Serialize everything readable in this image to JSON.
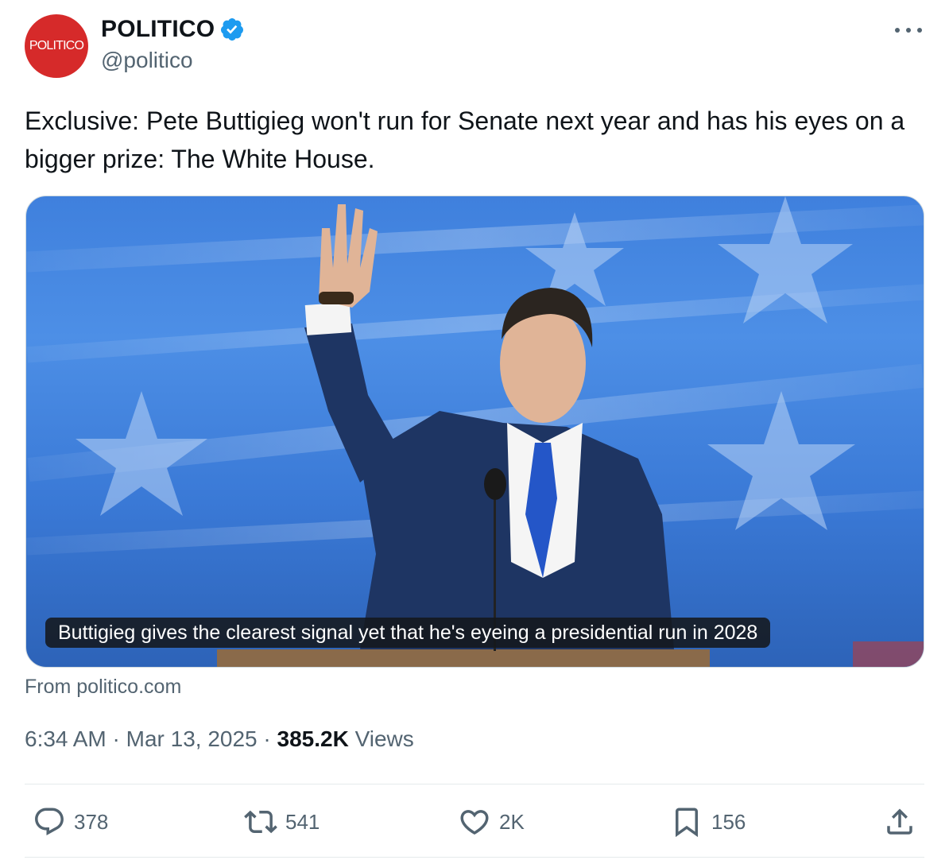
{
  "author": {
    "avatar_text": "POLITICO",
    "display_name": "POLITICO",
    "handle": "@politico",
    "verified": true,
    "brand_color": "#d62a2a",
    "verified_color": "#1d9bf0"
  },
  "tweet": {
    "text": "Exclusive: Pete Buttigieg won't run for Senate next year and has his eyes on a bigger prize: The White House."
  },
  "media": {
    "caption": "Buttigieg gives the clearest signal yet that he's eyeing a presidential run in 2028",
    "source": "From politico.com"
  },
  "meta": {
    "time": "6:34 AM",
    "date": "Mar 13, 2025",
    "views_count": "385.2K",
    "views_label": "Views"
  },
  "actions": {
    "replies": "378",
    "reposts": "541",
    "likes": "2K",
    "bookmarks": "156"
  }
}
